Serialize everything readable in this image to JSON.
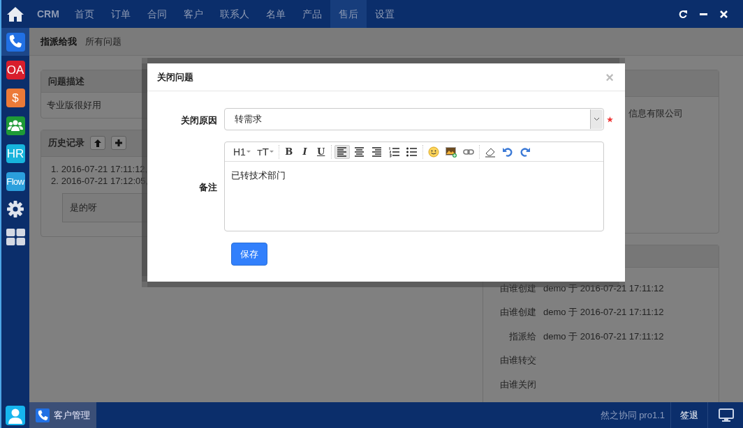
{
  "top_nav": {
    "brand": "CRM",
    "items": [
      {
        "label": "首页",
        "selected": false
      },
      {
        "label": "订单",
        "selected": false
      },
      {
        "label": "合同",
        "selected": false
      },
      {
        "label": "客户",
        "selected": false
      },
      {
        "label": "联系人",
        "selected": false
      },
      {
        "label": "名单",
        "selected": false
      },
      {
        "label": "产品",
        "selected": false
      },
      {
        "label": "售后",
        "selected": true
      },
      {
        "label": "设置",
        "selected": false
      }
    ]
  },
  "sidebar": {
    "apps": [
      {
        "kind": "phone",
        "color": "#2170e4",
        "selected": true
      },
      {
        "kind": "text",
        "label": "OA",
        "color": "#d81e2c",
        "selected": false
      },
      {
        "kind": "text",
        "label": "$",
        "color": "#ec7a38",
        "selected": false
      },
      {
        "kind": "group",
        "color": "#1e9a36",
        "selected": false
      },
      {
        "kind": "text",
        "label": "HR",
        "color": "#17b4dc",
        "selected": false
      },
      {
        "kind": "text",
        "label": "Flow",
        "color": "#2b9fdc",
        "selected": false
      },
      {
        "kind": "gear",
        "selected": false
      },
      {
        "kind": "grid",
        "selected": false
      }
    ]
  },
  "subnav": {
    "items": [
      {
        "label": "指派给我",
        "selected": true
      },
      {
        "label": "所有问题",
        "selected": false
      }
    ]
  },
  "description_card": {
    "title": "问题描述",
    "text": "专业版很好用"
  },
  "history_card": {
    "title": "历史记录",
    "entries": [
      {
        "number": "1.",
        "text": "2016-07-21 17:11:12,"
      },
      {
        "number": "2.",
        "text": "2016-07-21 17:12:05,"
      }
    ],
    "quote": "是的呀"
  },
  "company_card": {
    "text": "信息有限公司"
  },
  "info_card": {
    "rows": [
      {
        "label": "由谁创建",
        "value": "demo 于 2016-07-21 17:11:12"
      },
      {
        "label": "由谁创建",
        "value": "demo 于 2016-07-21 17:11:12"
      },
      {
        "label": "指派给",
        "value": "demo 于 2016-07-21 17:11:12"
      },
      {
        "label": "由谁转交"
      },
      {
        "label": "由谁关闭"
      }
    ]
  },
  "modal": {
    "title": "关闭问题",
    "close": "×",
    "fields": [
      {
        "kind": "select",
        "label": "关闭原因",
        "value": "转需求",
        "required": true
      },
      {
        "kind": "editor",
        "label": "备注",
        "value": "已转技术部门",
        "required": false
      }
    ],
    "toolbar": [
      [
        {
          "kind": "heading",
          "label": "H1",
          "selected": false
        },
        {
          "kind": "fontsize",
          "label": "ᴛT",
          "selected": false
        }
      ],
      [
        {
          "kind": "bold",
          "label": "B",
          "selected": false
        },
        {
          "kind": "italic",
          "label": "I",
          "selected": false
        },
        {
          "kind": "underline",
          "label": "U",
          "selected": false
        }
      ],
      [
        {
          "kind": "align-left",
          "selected": true
        },
        {
          "kind": "align-center",
          "selected": false
        },
        {
          "kind": "align-right",
          "selected": false
        },
        {
          "kind": "ordered-list",
          "selected": false
        },
        {
          "kind": "bullet-list",
          "selected": false
        }
      ],
      [
        {
          "kind": "emoji",
          "selected": false
        },
        {
          "kind": "image",
          "selected": false
        },
        {
          "kind": "link",
          "selected": false
        }
      ],
      [
        {
          "kind": "eraser",
          "selected": false
        },
        {
          "kind": "undo",
          "selected": false
        },
        {
          "kind": "redo",
          "selected": false
        }
      ]
    ],
    "save": "保存"
  },
  "taskbar": {
    "tasks": [
      {
        "label": "客户管理",
        "selected": true
      }
    ],
    "product": "然之协同 pro1.1",
    "signout": "签退"
  }
}
